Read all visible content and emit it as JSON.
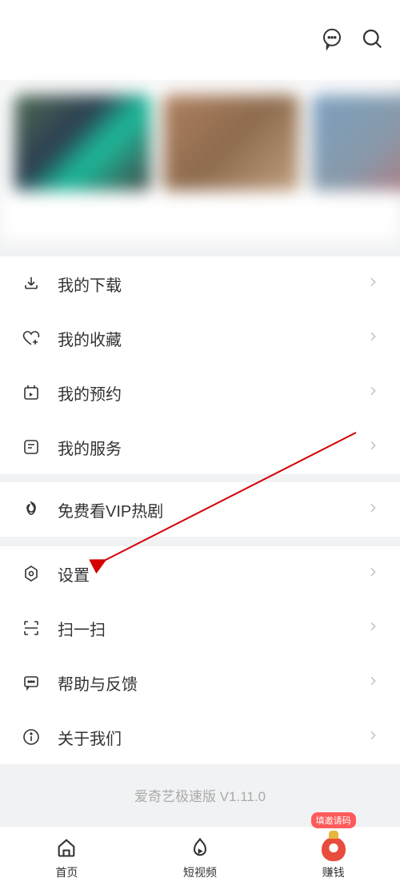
{
  "header": {
    "chat_icon_name": "chat-icon",
    "search_icon_name": "search-icon"
  },
  "groups": [
    {
      "items": [
        {
          "key": "downloads",
          "label": "我的下载"
        },
        {
          "key": "favorites",
          "label": "我的收藏"
        },
        {
          "key": "reserve",
          "label": "我的预约"
        },
        {
          "key": "services",
          "label": "我的服务"
        }
      ]
    },
    {
      "items": [
        {
          "key": "vip-hot",
          "label": "免费看VIP热剧"
        }
      ]
    },
    {
      "items": [
        {
          "key": "settings",
          "label": "设置"
        },
        {
          "key": "scan",
          "label": "扫一扫"
        },
        {
          "key": "help",
          "label": "帮助与反馈"
        },
        {
          "key": "about",
          "label": "关于我们"
        }
      ]
    }
  ],
  "footer_note": "爱奇艺极速版 V1.11.0",
  "tabs": {
    "home": "首页",
    "short": "短视频",
    "earn": "赚钱",
    "earn_bubble": "填邀请码"
  }
}
